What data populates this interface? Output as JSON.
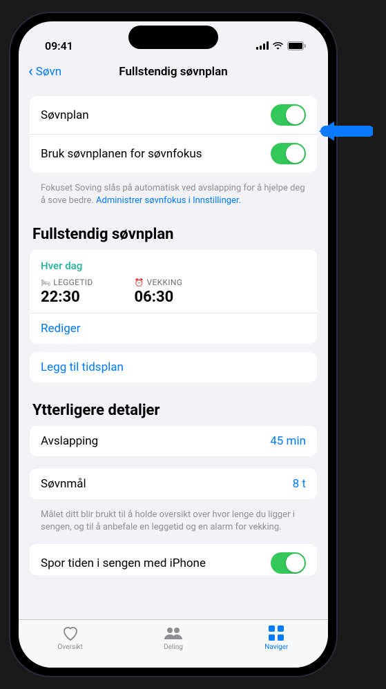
{
  "statusBar": {
    "time": "09:41"
  },
  "nav": {
    "back": "Søvn",
    "title": "Fullstendig søvnplan"
  },
  "toggles": {
    "sleepSchedule": {
      "label": "Søvnplan"
    },
    "useForFocus": {
      "label": "Bruk søvnplanen for søvnfokus"
    },
    "footer": "Fokuset Soving slås på automatisk ved avslapping for å hjelpe deg å sove bedre. ",
    "footerLink": "Administrer søvnfokus i Innstillinger."
  },
  "fullSchedule": {
    "header": "Fullstendig søvnplan",
    "everyDay": "Hver dag",
    "bedtimeLabel": "LEGGETID",
    "bedtimeValue": "22:30",
    "wakeLabel": "VEKKING",
    "wakeValue": "06:30",
    "edit": "Rediger",
    "add": "Legg til tidsplan"
  },
  "details": {
    "header": "Ytterligere detaljer",
    "windDown": {
      "label": "Avslapping",
      "value": "45 min"
    },
    "sleepGoal": {
      "label": "Søvnmål",
      "value": "8 t"
    },
    "footer": "Målet ditt blir brukt til å holde oversikt over hvor lenge du ligger i sengen, og til å anbefale en leggetid og en alarm for vekking.",
    "trackTime": {
      "label": "Spor tiden i sengen med iPhone"
    }
  },
  "tabs": {
    "summary": "Oversikt",
    "sharing": "Deling",
    "browse": "Naviger"
  }
}
